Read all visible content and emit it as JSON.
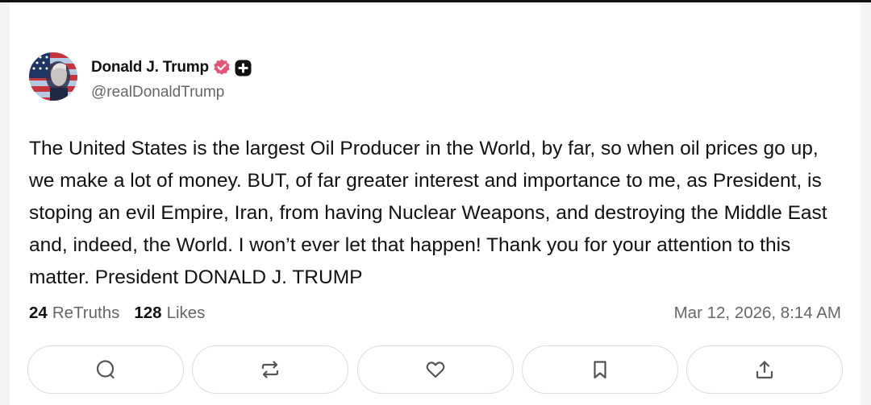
{
  "author": {
    "display_name": "Donald J. Trump",
    "handle": "@realDonaldTrump",
    "avatar_icon": "avatar-flag-portrait",
    "verified_icon": "verified-badge-icon",
    "plus_icon": "plus-badge-icon"
  },
  "post": {
    "text": "The United States is the largest Oil Producer in the World, by far, so when oil prices go up, we make a lot of money. BUT, of far greater interest and importance to me, as President, is stoping an evil Empire, Iran, from having Nuclear Weapons, and destroying the Middle East and, indeed, the World. I won’t ever let that happen! Thank you for your attention to this matter. President DONALD J. TRUMP"
  },
  "stats": {
    "retruths_count": "24",
    "retruths_label": "ReTruths",
    "likes_count": "128",
    "likes_label": "Likes"
  },
  "timestamp": "Mar 12, 2026, 8:14 AM",
  "actions": [
    {
      "icon": "reply-icon"
    },
    {
      "icon": "retruth-icon"
    },
    {
      "icon": "like-icon"
    },
    {
      "icon": "bookmark-icon"
    },
    {
      "icon": "share-icon"
    }
  ],
  "colors": {
    "verified": "#e1577a",
    "text": "#111111",
    "muted": "#666666",
    "border": "#dcdcdc"
  }
}
